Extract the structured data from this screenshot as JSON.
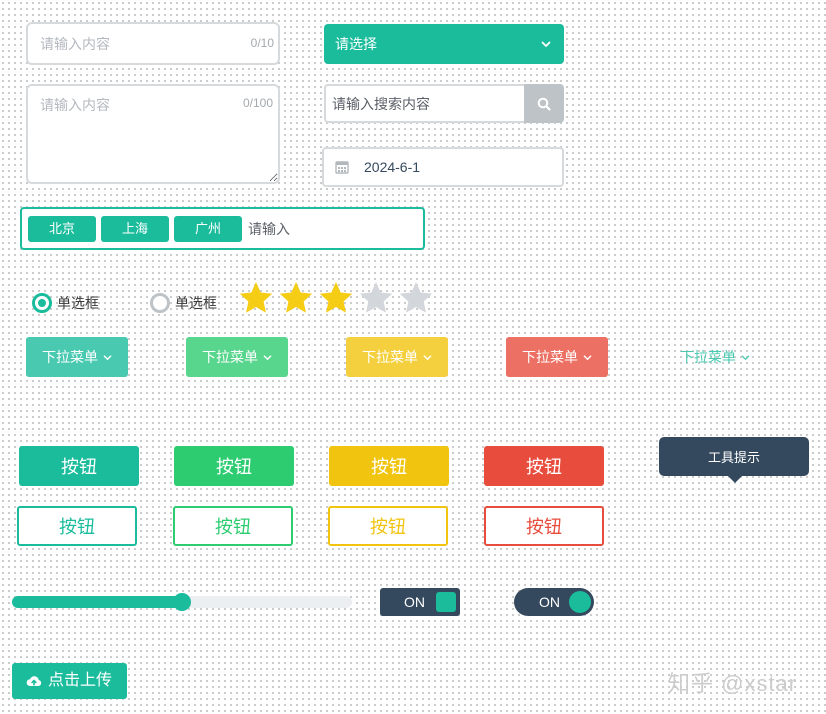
{
  "colors": {
    "teal": "#1abc9c",
    "green": "#2ecc71",
    "yellow": "#f1c40f",
    "red": "#e74c3c",
    "dark": "#34495e",
    "gray": "#bdc3c7"
  },
  "text_input": {
    "placeholder": "请输入内容",
    "counter": "0/10"
  },
  "textarea": {
    "placeholder": "请输入内容",
    "counter": "0/100"
  },
  "select": {
    "value": "请选择",
    "icon": "chevron-down-icon"
  },
  "search": {
    "placeholder": "请输入搜索内容",
    "icon": "search-icon"
  },
  "date_input": {
    "value": "2024-6-1",
    "icon": "calendar-icon"
  },
  "tag_input": {
    "tags": [
      "北京",
      "上海",
      "广州"
    ],
    "placeholder": "请输入"
  },
  "radios": [
    {
      "label": "单选框",
      "checked": true
    },
    {
      "label": "单选框",
      "checked": false
    }
  ],
  "rating": {
    "value": 3,
    "max": 5,
    "icon": "star-icon"
  },
  "dropdowns": [
    {
      "label": "下拉菜单",
      "color": "#48c9b0",
      "icon": "chevron-down-icon"
    },
    {
      "label": "下拉菜单",
      "color": "#58d68d",
      "icon": "chevron-down-icon"
    },
    {
      "label": "下拉菜单",
      "color": "#f4d03f",
      "icon": "chevron-down-icon"
    },
    {
      "label": "下拉菜单",
      "color": "#ec7063",
      "icon": "chevron-down-icon"
    },
    {
      "label": "下拉菜单",
      "color": "#48c9b0",
      "icon": "chevron-down-icon"
    }
  ],
  "buttons": {
    "solid": [
      {
        "label": "按钮",
        "color": "#1abc9c"
      },
      {
        "label": "按钮",
        "color": "#2ecc71"
      },
      {
        "label": "按钮",
        "color": "#f1c40f"
      },
      {
        "label": "按钮",
        "color": "#e74c3c"
      }
    ],
    "outline": [
      {
        "label": "按钮",
        "color": "#1abc9c"
      },
      {
        "label": "按钮",
        "color": "#2ecc71"
      },
      {
        "label": "按钮",
        "color": "#f1c40f"
      },
      {
        "label": "按钮",
        "color": "#e74c3c"
      }
    ]
  },
  "tooltip": {
    "text": "工具提示"
  },
  "slider": {
    "value_percent": 50
  },
  "switches": [
    {
      "label": "ON",
      "on": true
    },
    {
      "label": "ON",
      "on": true
    }
  ],
  "upload": {
    "label": "点击上传",
    "icon": "cloud-upload-icon"
  },
  "watermark": {
    "text": "知乎 @xstar"
  }
}
